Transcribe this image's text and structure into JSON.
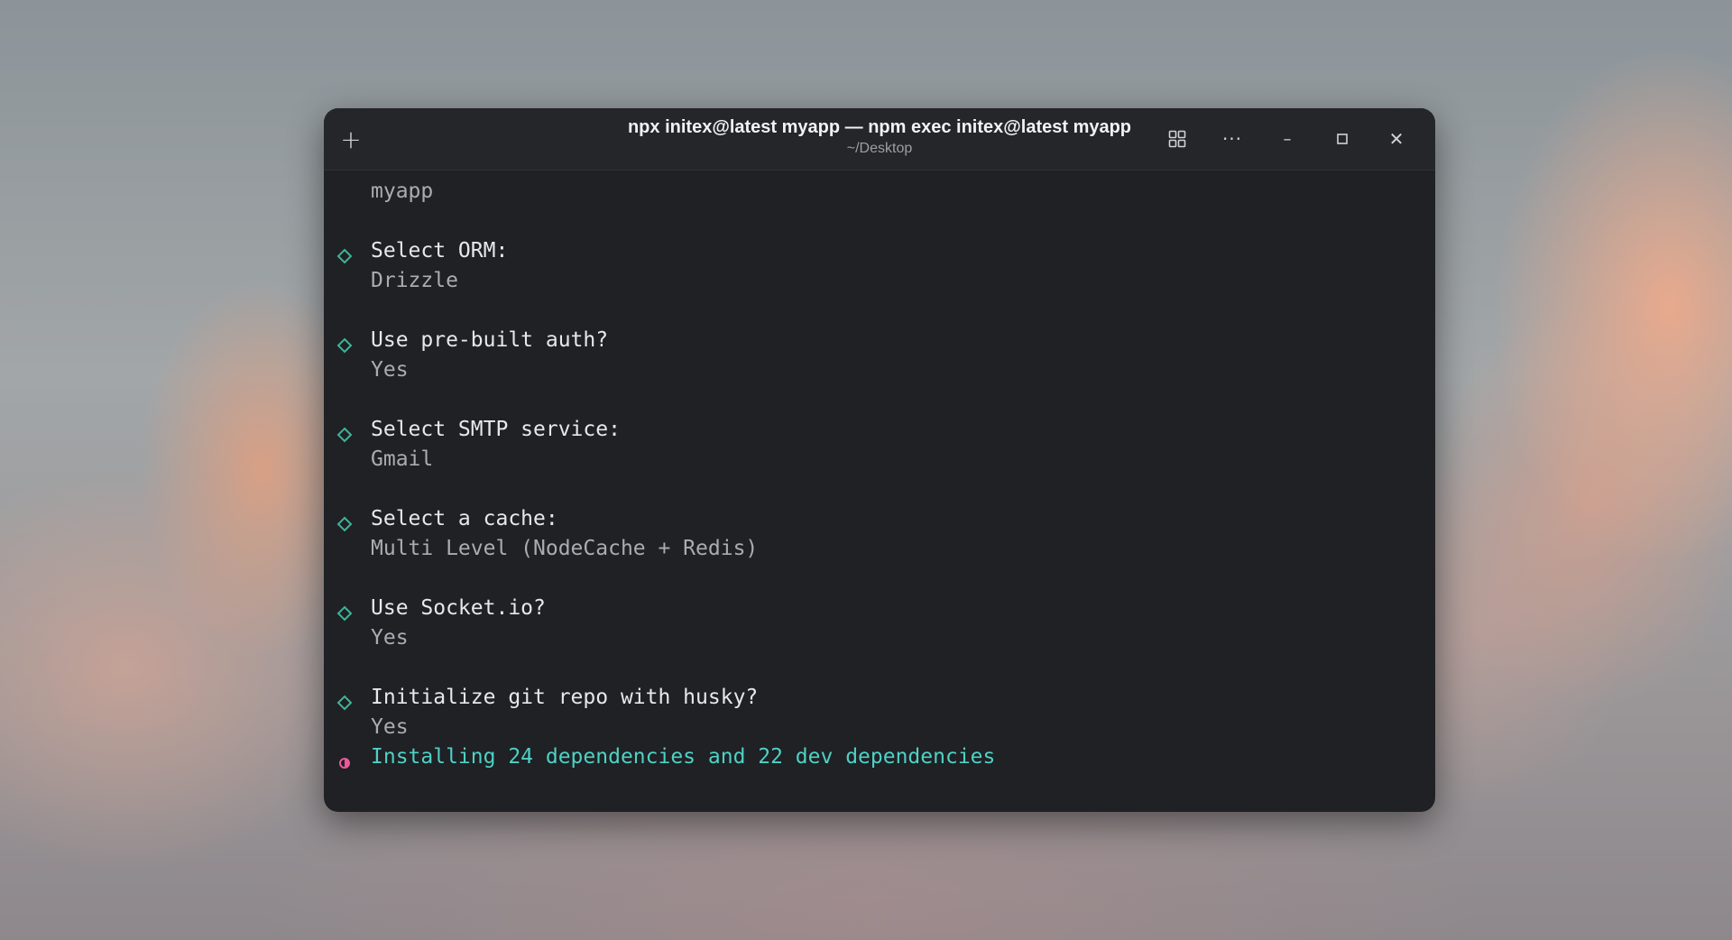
{
  "window": {
    "title": "npx initex@latest myapp — npm exec initex@latest myapp",
    "subtitle": "~/Desktop",
    "buttons": {
      "new_tab": "+",
      "more": "···",
      "minimize": "–",
      "close": "✕"
    }
  },
  "terminal": {
    "project_name": "myapp",
    "steps": [
      {
        "prompt": "Select ORM:",
        "answer": "Drizzle"
      },
      {
        "prompt": "Use pre-built auth?",
        "answer": "Yes"
      },
      {
        "prompt": "Select SMTP service:",
        "answer": "Gmail"
      },
      {
        "prompt": "Select a cache:",
        "answer": "Multi Level (NodeCache + Redis)"
      },
      {
        "prompt": "Use Socket.io?",
        "answer": "Yes"
      },
      {
        "prompt": "Initialize git repo with husky?",
        "answer": "Yes"
      }
    ],
    "status": "Installing 24 dependencies and 22 dev dependencies"
  },
  "colors": {
    "terminal_bg": "#1f2124",
    "titlebar_bg": "#242629",
    "step_marker": "#3fb39a",
    "status_text": "#4fd1c5",
    "spinner": "#e85a9a"
  },
  "icons": [
    "plus-icon",
    "grid-icon",
    "more-icon",
    "minimize-icon",
    "maximize-icon",
    "close-icon",
    "diamond-icon",
    "spinner-icon"
  ]
}
